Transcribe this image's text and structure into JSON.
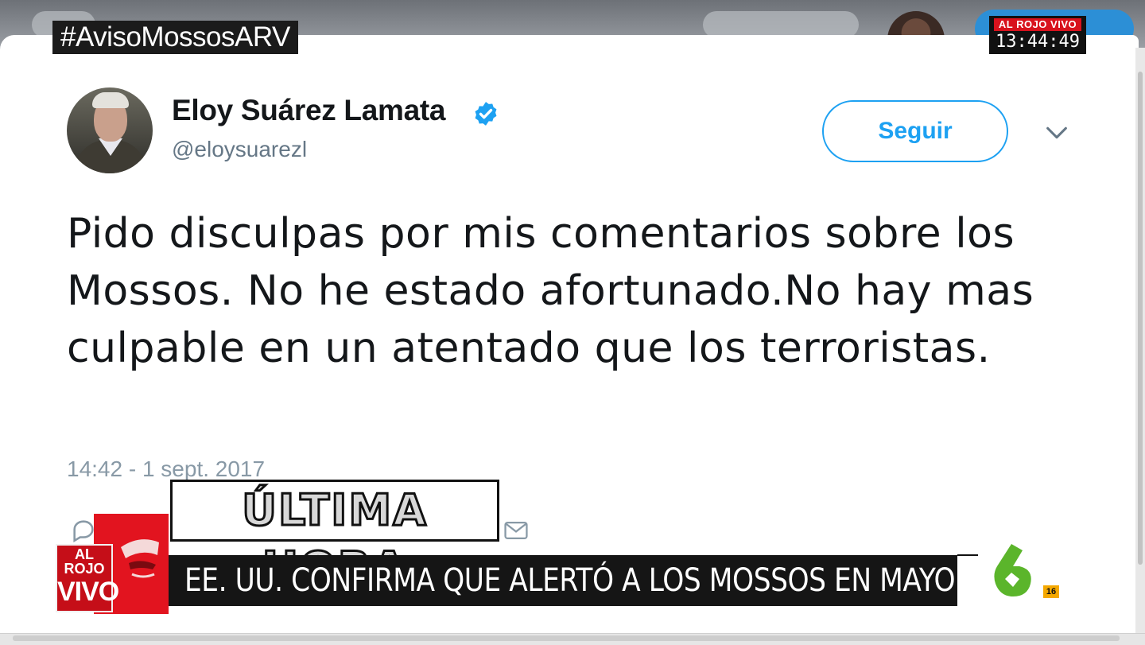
{
  "overlay": {
    "hashtag": "#AvisoMossosARV",
    "channel_brand": "AL ROJO VIVO",
    "clock": "13:44:49"
  },
  "tweet": {
    "author_name": "Eloy Suárez Lamata",
    "handle": "@eloysuarezl",
    "follow_label": "Seguir",
    "text": "Pido disculpas por mis comentarios sobre los Mossos. No he estado afortunado.No hay mas culpable en un atentado que los terroristas.",
    "timestamp": "14:42 - 1 sept. 2017",
    "verified": true
  },
  "ticker": {
    "breaking_label": "ÚLTIMA HORA",
    "headline": "EE. UU. CONFIRMA QUE ALERTÓ A LOS MOSSOS EN MAYO",
    "program_logo_line1": "AL ROJO",
    "program_logo_line2": "VIVO",
    "rating": "16"
  },
  "colors": {
    "twitter_blue": "#1da1f2",
    "brand_red": "#e2141f",
    "la6_green": "#5bb52b",
    "text_primary": "#14171a",
    "text_secondary": "#657786"
  },
  "icons": [
    "verified-icon",
    "chevron-down-icon",
    "reply-icon",
    "mail-icon",
    "la6-logo-icon"
  ]
}
